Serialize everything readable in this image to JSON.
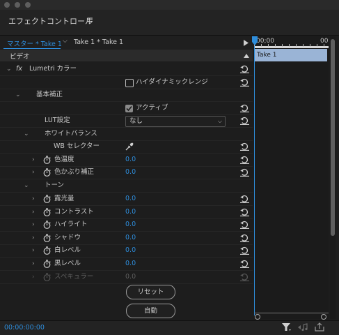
{
  "panel": {
    "title": "エフェクトコントロール"
  },
  "tabs": {
    "master": "マスター * Take 1",
    "clip": "Take 1 * Take 1"
  },
  "timeline": {
    "start": "00;00",
    "end": "00",
    "clip_label": "Take 1"
  },
  "section": {
    "video": "ビデオ"
  },
  "effect": {
    "fx": "fx",
    "name": "Lumetri カラー"
  },
  "hdr": {
    "label": "ハイダイナミックレンジ",
    "checked": false
  },
  "basic": {
    "label": "基本補正",
    "active": {
      "label": "アクティブ",
      "checked": true
    },
    "lut": {
      "label": "LUT設定",
      "value": "なし"
    },
    "wb": {
      "label": "ホワイトバランス",
      "selector": "WB セレクター",
      "params": [
        {
          "label": "色温度",
          "value": "0.0"
        },
        {
          "label": "色かぶり補正",
          "value": "0.0"
        }
      ]
    },
    "tone": {
      "label": "トーン",
      "params": [
        {
          "label": "露光量",
          "value": "0.0"
        },
        {
          "label": "コントラスト",
          "value": "0.0"
        },
        {
          "label": "ハイライト",
          "value": "0.0"
        },
        {
          "label": "シャドウ",
          "value": "0.0"
        },
        {
          "label": "白レベル",
          "value": "0.0"
        },
        {
          "label": "黒レベル",
          "value": "0.0"
        },
        {
          "label": "スペキュラー",
          "value": "0.0",
          "disabled": true
        }
      ]
    }
  },
  "buttons": {
    "reset": "リセット",
    "auto": "自動"
  },
  "footer": {
    "timecode": "00:00:00:00"
  },
  "colors": {
    "accent": "#2e8ddb",
    "clip": "#9ab4d6",
    "panel_bg": "#1d1d1d"
  }
}
